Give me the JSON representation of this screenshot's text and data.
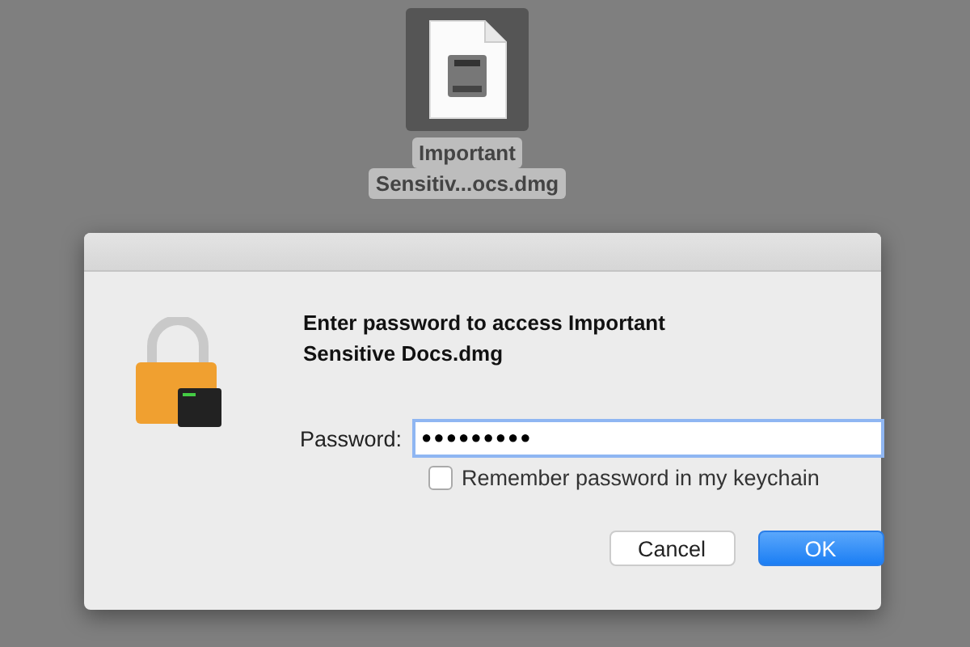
{
  "desktop_icon": {
    "label_lines": [
      "Important",
      "Sensitiv...ocs.dmg"
    ],
    "selected": true
  },
  "dialog": {
    "message": "Enter password to access Important Sensitive Docs.dmg",
    "password_label": "Password:",
    "password_value": "●●●●●●●●●",
    "remember": {
      "label": "Remember password in my keychain",
      "checked": false
    },
    "buttons": [
      {
        "label": "Cancel",
        "kind": "secondary"
      },
      {
        "label": "OK",
        "kind": "default"
      }
    ]
  }
}
